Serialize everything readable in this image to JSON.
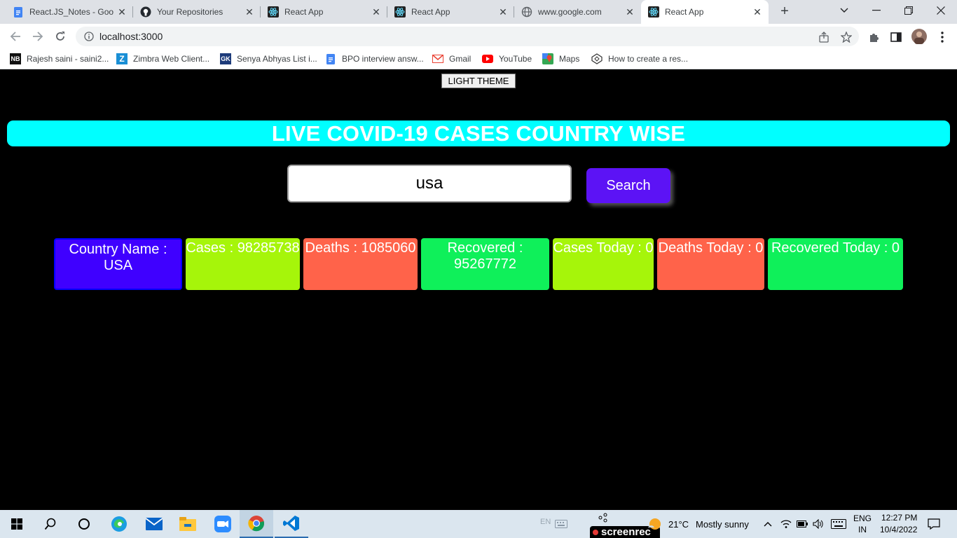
{
  "browser": {
    "tabs": [
      {
        "title": "React.JS_Notes - Goo",
        "icon": "google-docs-icon"
      },
      {
        "title": "Your Repositories",
        "icon": "github-icon"
      },
      {
        "title": "React App",
        "icon": "react-icon"
      },
      {
        "title": "React App",
        "icon": "react-icon"
      },
      {
        "title": "www.google.com",
        "icon": "globe-icon"
      },
      {
        "title": "React App",
        "icon": "react-icon",
        "active": true
      }
    ],
    "url": "localhost:3000",
    "bookmarks": [
      {
        "label": "Rajesh saini - saini2...",
        "icon": "nb-icon"
      },
      {
        "label": "Zimbra Web Client...",
        "icon": "zimbra-icon"
      },
      {
        "label": "Senya Abhyas List i...",
        "icon": "gk-icon"
      },
      {
        "label": "BPO interview answ...",
        "icon": "google-docs-icon"
      },
      {
        "label": "Gmail",
        "icon": "gmail-icon"
      },
      {
        "label": "YouTube",
        "icon": "youtube-icon"
      },
      {
        "label": "Maps",
        "icon": "maps-icon"
      },
      {
        "label": "How to create a res...",
        "icon": "codepen-icon"
      }
    ]
  },
  "page": {
    "theme_button": "LIGHT THEME",
    "heading": "LIVE COVID-19 CASES COUNTRY WISE",
    "search": {
      "value": "usa",
      "button": "Search"
    },
    "stats": [
      {
        "label": "Country Name : USA",
        "color": "#3f00ff"
      },
      {
        "label": "Cases : 98285738",
        "color": "#a6f50a"
      },
      {
        "label": "Deaths : 1085060",
        "color": "#ff634a"
      },
      {
        "label": "Recovered : 95267772",
        "color": "#0ff05a"
      },
      {
        "label": "Cases Today : 0",
        "color": "#a6f50a"
      },
      {
        "label": "Deaths Today : 0",
        "color": "#ff634a"
      },
      {
        "label": "Recovered Today : 0",
        "color": "#0ff05a"
      }
    ]
  },
  "taskbar": {
    "weather": {
      "temp": "21°C",
      "condition": "Mostly sunny"
    },
    "language": {
      "lang": "ENG",
      "region": "IN"
    },
    "clock": {
      "time": "12:27 PM",
      "date": "10/4/2022"
    },
    "watermark": "screenrec"
  }
}
